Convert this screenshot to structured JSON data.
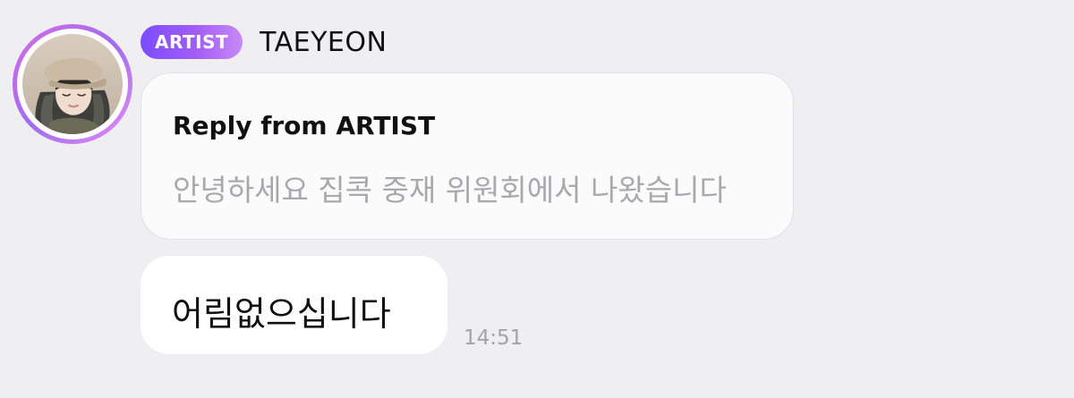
{
  "sender": {
    "badge": "ARTIST",
    "name": "TAEYEON"
  },
  "reply": {
    "title": "Reply from ARTIST",
    "quoted_text": "안녕하세요 집콕 중재 위원회에서 나왔습니다"
  },
  "message": {
    "text": "어림없으십니다",
    "time": "14:51"
  },
  "colors": {
    "background": "#efeff1",
    "badge_start": "#7c4dff",
    "badge_end": "#c78af7",
    "avatar_ring": "#b36cf0",
    "bubble": "#ffffff",
    "muted_text": "#a9a9ad"
  }
}
